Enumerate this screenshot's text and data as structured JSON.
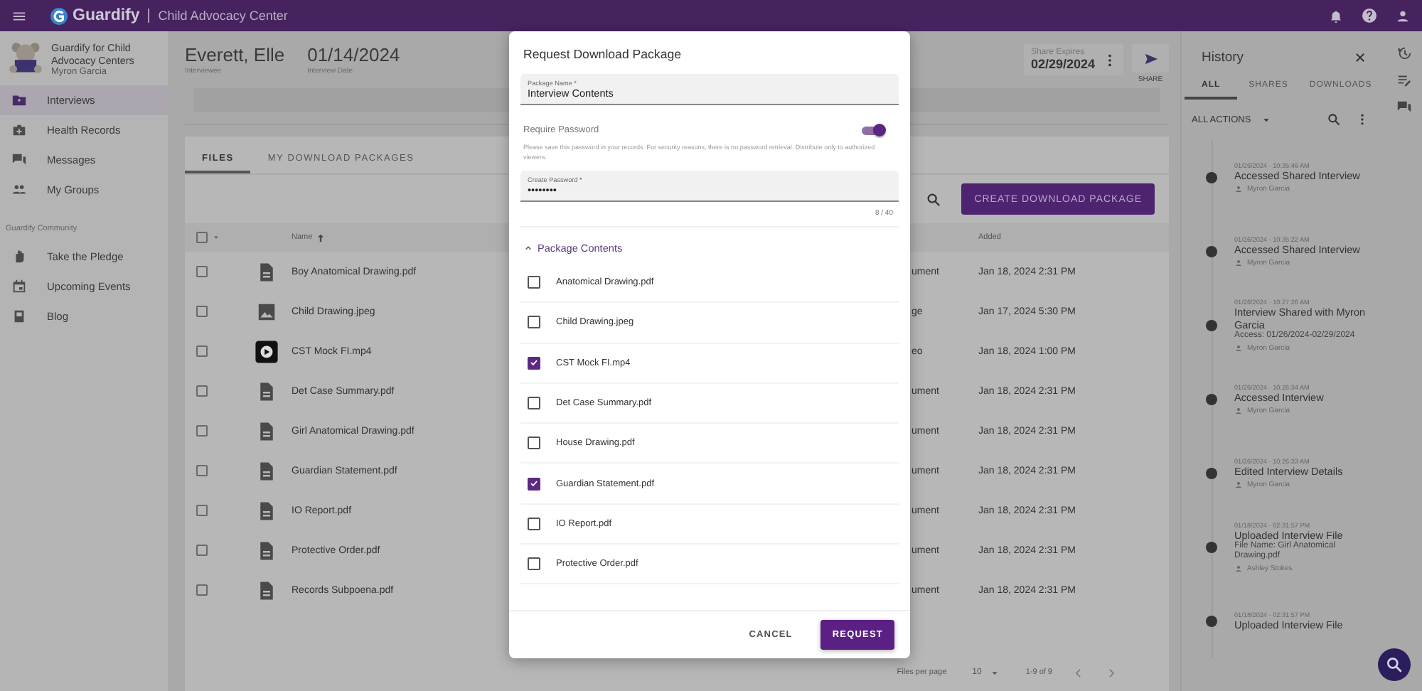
{
  "app_bar": {
    "title": "Guardify",
    "subtitle": "Child Advocacy Center"
  },
  "sidebar": {
    "org": "Guardify for Child Advocacy Centers",
    "user": "Myron Garcia",
    "items": [
      {
        "label": "Interviews",
        "selected": true
      },
      {
        "label": "Health Records",
        "selected": false
      },
      {
        "label": "Messages",
        "selected": false
      },
      {
        "label": "My Groups",
        "selected": false
      }
    ],
    "section_label": "Guardify Community",
    "community_items": [
      {
        "label": "Take the Pledge",
        "selected": false
      },
      {
        "label": "Upcoming Events",
        "selected": false
      },
      {
        "label": "Blog",
        "selected": false
      }
    ]
  },
  "header": {
    "name": "Everett, Elle",
    "name_label": "Interviewee",
    "date": "01/14/2024",
    "date_label": "Interview Date",
    "share_expires_label": "Share Expires",
    "share_expires": "02/29/2024",
    "share_label": "SHARE"
  },
  "tabs": [
    {
      "label": "FILES",
      "selected": true
    },
    {
      "label": "MY DOWNLOAD PACKAGES",
      "selected": false
    }
  ],
  "create_button": "CREATE DOWNLOAD PACKAGE",
  "table": {
    "checked": false,
    "name_column": "Name",
    "added_column": "Added",
    "rows": [
      {
        "kind": "document",
        "name": "Boy Anatomical Drawing.pdf",
        "column_4": "ument",
        "added": "Jan 18, 2024 2:31 PM",
        "checked": false
      },
      {
        "kind": "image",
        "name": "Child Drawing.jpeg",
        "column_4": "ge",
        "added": "Jan 17, 2024 5:30 PM",
        "checked": false
      },
      {
        "kind": "video",
        "name": "CST Mock FI.mp4",
        "column_4": "eo",
        "added": "Jan 18, 2024 1:00 PM",
        "checked": false
      },
      {
        "kind": "document",
        "name": "Det Case Summary.pdf",
        "column_4": "ument",
        "added": "Jan 18, 2024 2:31 PM",
        "checked": false
      },
      {
        "kind": "document",
        "name": "Girl Anatomical Drawing.pdf",
        "column_4": "ument",
        "added": "Jan 18, 2024 2:31 PM",
        "checked": false
      },
      {
        "kind": "document",
        "name": "Guardian Statement.pdf",
        "column_4": "ument",
        "added": "Jan 18, 2024 2:31 PM",
        "checked": false
      },
      {
        "kind": "document",
        "name": "IO Report.pdf",
        "column_4": "ument",
        "added": "Jan 18, 2024 2:31 PM",
        "checked": false
      },
      {
        "kind": "document",
        "name": "Protective Order.pdf",
        "column_4": "ument",
        "added": "Jan 18, 2024 2:31 PM",
        "checked": false
      },
      {
        "kind": "document",
        "name": "Records Subpoena.pdf",
        "column_4": "ument",
        "added": "Jan 18, 2024 2:31 PM",
        "checked": false
      }
    ]
  },
  "pagination": {
    "per_page_label": "Files per page",
    "per_page": "10",
    "range": "1-9 of 9"
  },
  "dialog": {
    "title": "Request Download Package",
    "package_name": {
      "label": "Package Name *",
      "value": "Interview Contents"
    },
    "require_password": {
      "label": "Require Password",
      "on": true
    },
    "password_hint": "Please save this password in your records. For security reasons, there is no password retrieval. Distribute only to authorized viewers.",
    "password": {
      "label": "Create Password *",
      "value": "••••••••",
      "counter": "8 / 40"
    },
    "contents": {
      "label": "Package Contents",
      "expanded": true,
      "items": [
        {
          "label": "Anatomical Drawing.pdf",
          "checked": false
        },
        {
          "label": "Child Drawing.jpeg",
          "checked": false
        },
        {
          "label": "CST Mock FI.mp4",
          "checked": true
        },
        {
          "label": "Det Case Summary.pdf",
          "checked": false
        },
        {
          "label": "House Drawing.pdf",
          "checked": false
        },
        {
          "label": "Guardian Statement.pdf",
          "checked": true
        },
        {
          "label": "IO Report.pdf",
          "checked": false
        },
        {
          "label": "Protective Order.pdf",
          "checked": false
        }
      ]
    },
    "buttons": [
      "CANCEL",
      "REQUEST"
    ]
  },
  "history": {
    "title": "History",
    "tabs": [
      {
        "label": "ALL",
        "selected": true
      },
      {
        "label": "SHARES",
        "selected": false
      },
      {
        "label": "DOWNLOADS",
        "selected": false
      }
    ],
    "filter": "ALL ACTIONS",
    "items": [
      {
        "time": "01/26/2024 · 10:35:46 AM",
        "title": "Accessed Shared Interview",
        "user": "Myron Garcia"
      },
      {
        "time": "01/26/2024 · 10:35:22 AM",
        "title": "Accessed Shared Interview",
        "user": "Myron Garcia"
      },
      {
        "time": "01/26/2024 · 10:27:26 AM",
        "title": "Interview Shared with Myron Garcia",
        "detail": "Access: 01/26/2024-02/29/2024",
        "user": "Myron Garcia"
      },
      {
        "time": "01/26/2024 · 10:26:34 AM",
        "title": "Accessed Interview",
        "user": "Myron Garcia"
      },
      {
        "time": "01/26/2024 · 10:26:33 AM",
        "title": "Edited Interview Details",
        "user": "Myron Garcia"
      },
      {
        "time": "01/18/2024 · 02:31:57 PM",
        "title": "Uploaded Interview File",
        "detail": "File Name: Girl Anatomical Drawing.pdf",
        "user": "Ashley Stokes"
      },
      {
        "time": "01/18/2024 · 02:31:57 PM",
        "title": "Uploaded Interview File"
      }
    ]
  }
}
